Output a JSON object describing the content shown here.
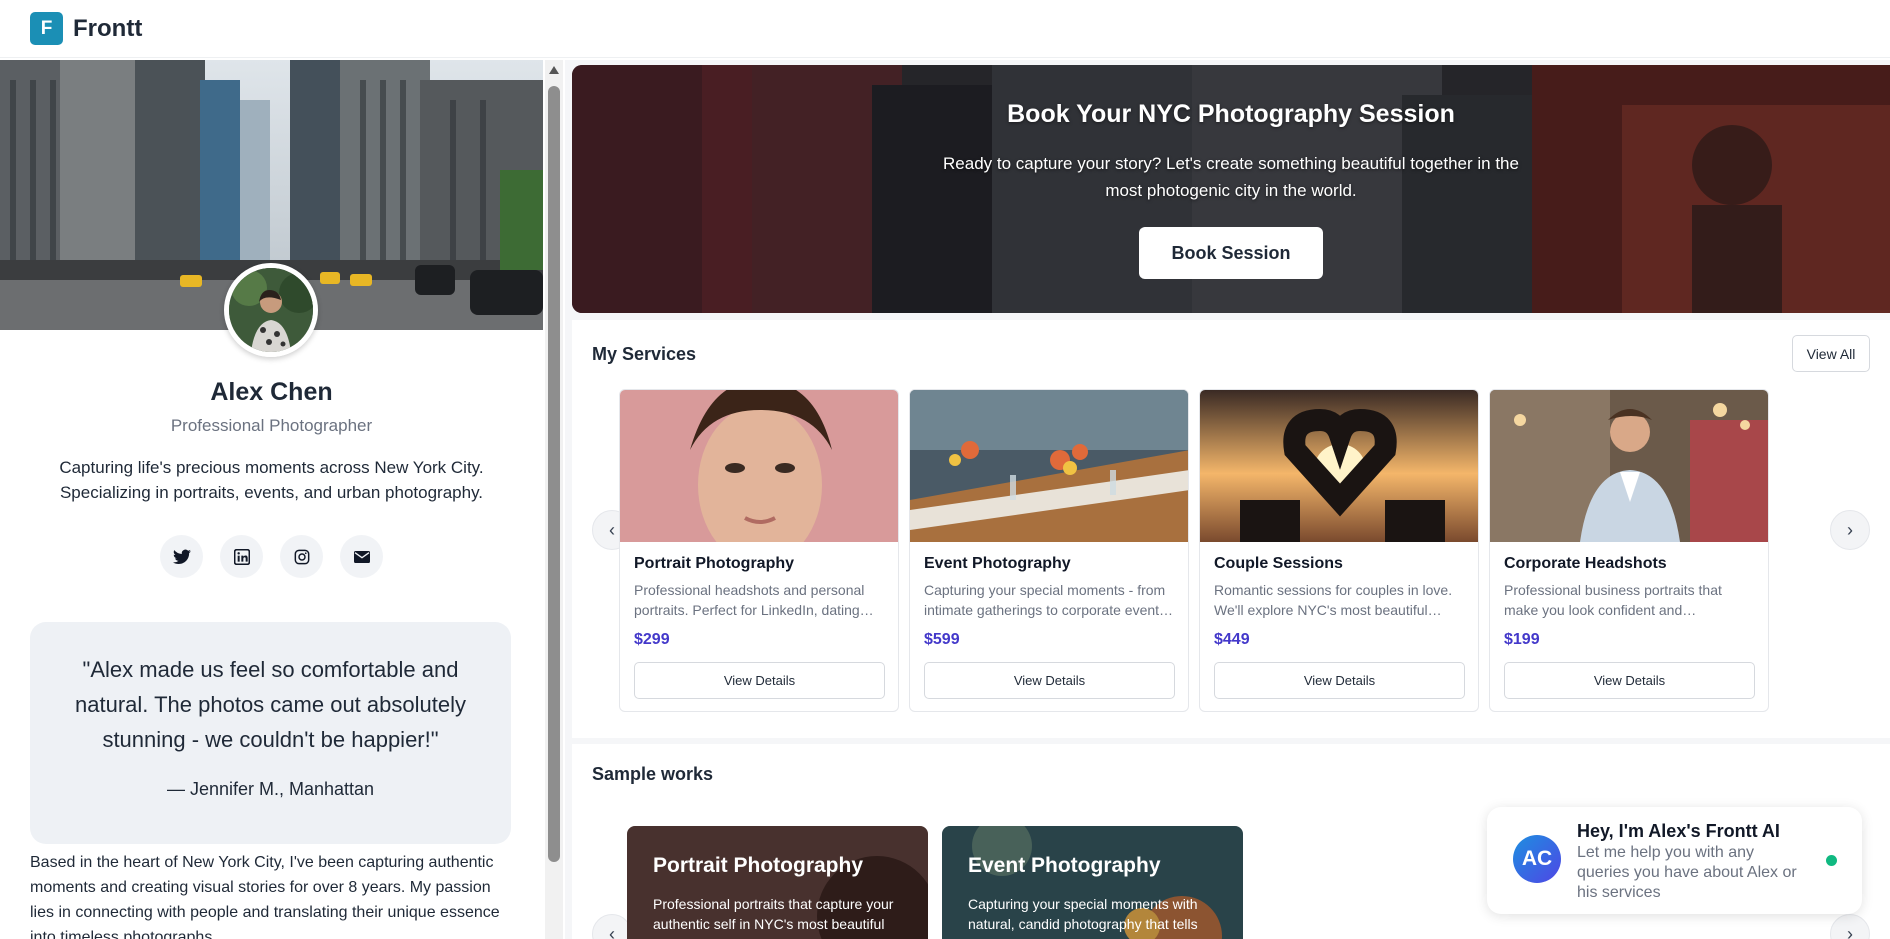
{
  "app": {
    "logo_letter": "F",
    "brand": "Frontt"
  },
  "profile": {
    "name": "Alex Chen",
    "role": "Professional Photographer",
    "bio": "Capturing life's precious moments across New York City. Specializing in portraits, events, and urban photography.",
    "socials": [
      "twitter-icon",
      "linkedin-icon",
      "instagram-icon",
      "mail-icon"
    ],
    "quote": "\"Alex made us feel so comfortable and natural. The photos came out absolutely stunning - we couldn't be happier!\"",
    "quote_author": "— Jennifer M., Manhattan",
    "about": "Based in the heart of New York City, I've been capturing authentic moments and creating visual stories for over 8 years. My passion lies in connecting with people and translating their unique essence into timeless photographs."
  },
  "hero": {
    "title": "Book Your NYC Photography Session",
    "subtitle": "Ready to capture your story? Let's create something beautiful together in the most photogenic city in the world.",
    "button": "Book Session"
  },
  "services": {
    "title": "My Services",
    "view_all": "View All",
    "prev": "‹",
    "next": "›",
    "items": [
      {
        "title": "Portrait Photography",
        "desc": "Professional headshots and personal portraits. Perfect for LinkedIn, dating…",
        "price": "$299",
        "button": "View Details"
      },
      {
        "title": "Event Photography",
        "desc": "Capturing your special moments - from intimate gatherings to corporate event…",
        "price": "$599",
        "button": "View Details"
      },
      {
        "title": "Couple Sessions",
        "desc": "Romantic sessions for couples in love. We'll explore NYC's most beautiful…",
        "price": "$449",
        "button": "View Details"
      },
      {
        "title": "Corporate Headshots",
        "desc": "Professional business portraits that make you look confident and…",
        "price": "$199",
        "button": "View Details"
      }
    ]
  },
  "samples": {
    "title": "Sample works",
    "prev": "‹",
    "next": "›",
    "items": [
      {
        "title": "Portrait Photography",
        "desc": "Professional portraits that capture your authentic self in NYC's most beautiful locations"
      },
      {
        "title": "Event Photography",
        "desc": "Capturing your special moments with natural, candid photography that tells your story"
      }
    ]
  },
  "chat": {
    "avatar": "AC",
    "title": "Hey, I'm Alex's Frontt AI",
    "text": "Let me help you with any queries you have about Alex or his services"
  },
  "colors": {
    "brand": "#1b8fb5",
    "price": "#4338ca",
    "online": "#10b981"
  }
}
